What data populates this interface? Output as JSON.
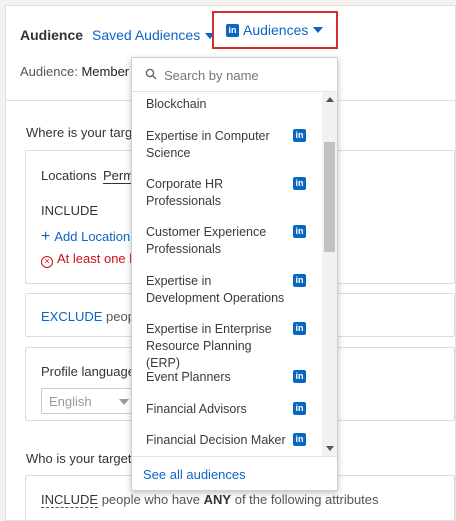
{
  "header": {
    "audience_label": "Audience",
    "saved_audiences_label": "Saved Audiences",
    "audiences_button_label": "Audiences",
    "audience_summary_prefix": "Audience:",
    "audience_summary_value": "Member"
  },
  "where": {
    "question": "Where is your targ",
    "locations_label": "Locations",
    "locations_value": "Perm",
    "include_label": "INCLUDE",
    "add_location_label": "Add Location",
    "error_text": "At least one l"
  },
  "exclude": {
    "keyword": "EXCLUDE",
    "rest": "people"
  },
  "language": {
    "label": "Profile language",
    "selected": "English"
  },
  "who": {
    "question": "Who is your target",
    "include_keyword": "INCLUDE",
    "include_rest_1": "people who have",
    "include_any": "ANY",
    "include_rest_2": "of the following attributes"
  },
  "dropdown": {
    "search_placeholder": "Search by name",
    "items": [
      {
        "label": "Blockchain"
      },
      {
        "label": "Expertise in Computer Science"
      },
      {
        "label": "Corporate HR Professionals"
      },
      {
        "label": "Customer Experience Professionals"
      },
      {
        "label": "Expertise in Development Operations"
      },
      {
        "label": "Expertise in Enterprise Resource Planning (ERP)"
      },
      {
        "label": "Event Planners"
      },
      {
        "label": "Financial Advisors"
      },
      {
        "label": "Financial Decision Maker"
      }
    ],
    "see_all_label": "See all audiences",
    "linkedin_badge": "in"
  },
  "colors": {
    "link_blue": "#0a66c2",
    "highlight_red": "#d42c2c",
    "error_red": "#cc1016"
  }
}
